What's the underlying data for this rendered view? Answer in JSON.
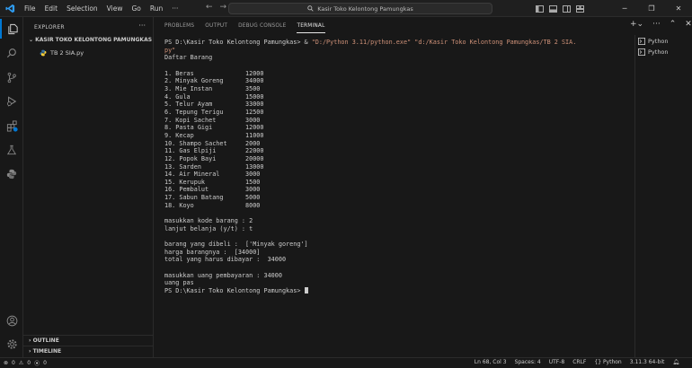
{
  "menu": [
    "File",
    "Edit",
    "Selection",
    "View",
    "Go",
    "Run",
    "···"
  ],
  "command_center": "Kasir Toko Kelontong Pamungkas",
  "sidebar": {
    "title": "EXPLORER",
    "folder": "KASIR TOKO KELONTONG PAMUNGKAS",
    "file": "TB 2 SIA.py",
    "outline": "OUTLINE",
    "timeline": "TIMELINE"
  },
  "panel": {
    "tabs": [
      "PROBLEMS",
      "OUTPUT",
      "DEBUG CONSOLE",
      "TERMINAL"
    ],
    "terminals": [
      "Python",
      "Python"
    ]
  },
  "terminal": {
    "cmd_prompt": "PS D:\\Kasir Toko Kelontong Pamungkas> & ",
    "cmd_exe": "\"D:/Python 3.11/python.exe\"",
    "cmd_script": " \"d:/Kasir Toko Kelontong Pamungkas/TB 2 SIA.",
    "cmd_wrap": "py\"",
    "body": "Daftar Barang\n\n1. Beras              12000\n2. Minyak Goreng      34000\n3. Mie Instan         3500\n4. Gula               15000\n5. Telur Ayam         33000\n6. Tepung Terigu      12500\n7. Kopi Sachet        3000\n8. Pasta Gigi         12000\n9. Kecap              11000\n10. Shampo Sachet     2000\n11. Gas Elpiji        22000\n12. Popok Bayi        20000\n13. Sarden            13000\n14. Air Mineral       3000\n15. Kerupuk           1500\n16. Pembalut          3000\n17. Sabun Batang      5000\n18. Koyo              8000\n\nmasukkan kode barang : 2\nlanjut belanja (y/t) : t\n\nbarang yang dibeli :  ['Minyak goreng']\nharga barangnya :  [34000]\ntotal yang harus dibayar :  34000\n\nmasukkan uang pembayaran : 34000\nuang pas\n",
    "final_prompt": "PS D:\\Kasir Toko Kelontong Pamungkas> "
  },
  "status": {
    "errors": "0",
    "warnings": "0",
    "port": "0",
    "position": "Ln 68, Col 3",
    "spaces": "Spaces: 4",
    "encoding": "UTF-8",
    "eol": "CRLF",
    "language": "Python",
    "interpreter": "3.11.3 64-bit"
  },
  "colors": {
    "accent": "#0078d4",
    "background": "#181818",
    "string": "#ce9178",
    "python_blue": "#3572A5",
    "python_yellow": "#FFD43B"
  }
}
